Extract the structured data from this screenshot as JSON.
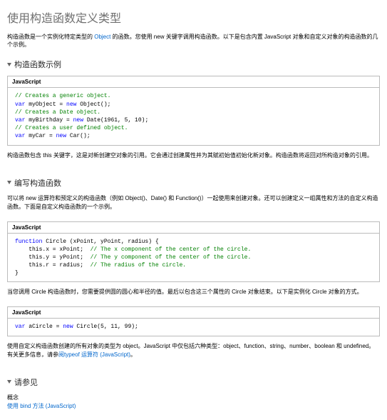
{
  "title": "使用构造函数定义类型",
  "intro_before": "构造函数是一个实例化特定类型的 ",
  "intro_link": "Object",
  "intro_after": " 的函数。您使用 new 关键字调用构造函数。以下是包含内置 JavaScript 对象和自定义对象的构造函数的几个示例。",
  "sec1_title": "构造函数示例",
  "codebox_lang": "JavaScript",
  "code1": {
    "c1": "// Creates a generic object.",
    "l1a": "var",
    "l1b": " myObject = ",
    "l1c": "new",
    "l1d": " Object();",
    "c2": "// Creates a Date object.",
    "l2a": "var",
    "l2b": " myBirthday = ",
    "l2c": "new",
    "l2d": " Date(1961, 5, 10);",
    "c3": "// Creates a user defined object.",
    "l3a": "var",
    "l3b": " myCar = ",
    "l3c": "new",
    "l3d": " Car();"
  },
  "p1": "构造函数包含 this 关键字，这是对新创建空对象的引用。它会通过创建属性并为其赋初始值初始化新对象。构造函数将返回对所构造对象的引用。",
  "sec2_title": "编写构造函数",
  "p2": "可以将 new 运算符和预定义的构造函数（例如 Object()、Date() 和 Function()）一起使用来创建对象。还可以创建定义一组属性和方法的自定义构造函数。下面是自定义构造函数的一个示例。",
  "code2": {
    "la": "function",
    "lb": " Circle (xPoint, yPoint, radius) {",
    "l1": "    this.x = xPoint;  ",
    "c1": "// The x component of the center of the circle.",
    "l2": "    this.y = yPoint;  ",
    "c2": "// The y component of the center of the circle.",
    "l3": "    this.r = radius;  ",
    "c3": "// The radius of the circle.",
    "end": "}"
  },
  "p3": "当您调用 Circle 构造函数时，您需要提供圆的圆心和半径的值。最后以包含这三个属性的 Circle 对象结束。以下是实例化 Circle 对象的方式。",
  "code3": {
    "a": "var",
    "b": " aCircle = ",
    "c": "new",
    "d": " Circle(5, 11, 99);"
  },
  "p4_before": "使用自定义构造函数创建的所有对象的类型为 object。JavaScript 中仅包括六种类型：object、function、string、number、boolean 和 undefined。有关更多信息，请参",
  "p4_link": "阅typeof 运算符 (JavaScript)",
  "p4_after": "。",
  "sec3_title": "请参见",
  "seealso_concept": "概念",
  "seealso_link": "使用 bind 方法 (JavaScript)"
}
